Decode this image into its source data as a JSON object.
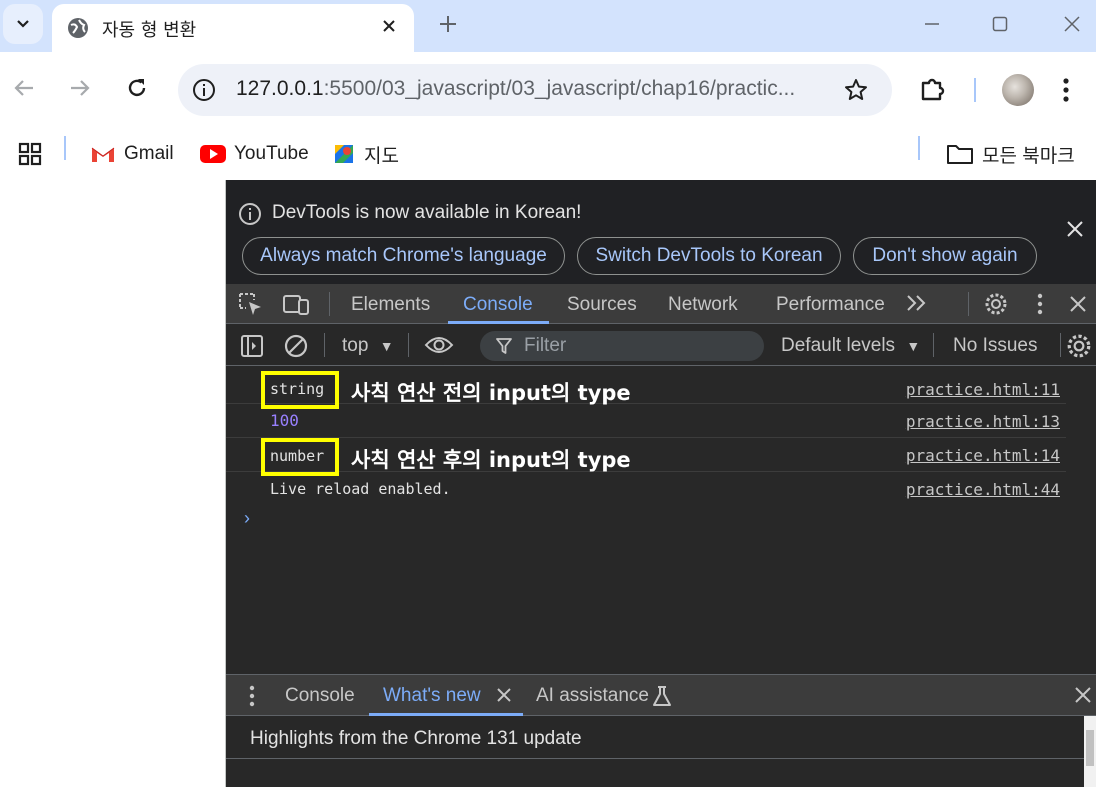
{
  "browser": {
    "tab": {
      "title": "자동 형 변환",
      "favicon": "globe-icon"
    },
    "window_controls": [
      "minimize-icon",
      "maximize-icon",
      "close-icon"
    ],
    "address": {
      "host": "127.0.0.1",
      "path": ":5500/03_javascript/03_javascript/chap16/practic..."
    },
    "bookmarks": [
      {
        "label": "Gmail",
        "icon": "gmail-icon"
      },
      {
        "label": "YouTube",
        "icon": "youtube-icon"
      },
      {
        "label": "지도",
        "icon": "maps-icon"
      }
    ],
    "all_bookmarks": "모든 북마크"
  },
  "devtools": {
    "infobar": {
      "message": "DevTools is now available in Korean!",
      "buttons": [
        "Always match Chrome's language",
        "Switch DevTools to Korean",
        "Don't show again"
      ]
    },
    "tabs": [
      "Elements",
      "Console",
      "Sources",
      "Network",
      "Performance"
    ],
    "active_tab": "Console",
    "toolbar": {
      "context": "top",
      "filter_placeholder": "Filter",
      "levels": "Default levels",
      "issues": "No Issues"
    },
    "messages": [
      {
        "text": "string",
        "source": "practice.html:11",
        "annotation": "사칙 연산 전의 input의 type",
        "highlighted": true
      },
      {
        "text": "100",
        "source": "practice.html:13",
        "color": "#9980ff"
      },
      {
        "text": "number",
        "source": "practice.html:14",
        "annotation": "사칙 연산 후의 input의 type",
        "highlighted": true
      },
      {
        "text": "Live reload enabled.",
        "source": "practice.html:44"
      }
    ],
    "drawer": {
      "tabs": [
        "Console",
        "What's new",
        "AI assistance"
      ],
      "active_tab": "What's new",
      "content": "Highlights from the Chrome 131 update"
    }
  },
  "colors": {
    "highlight_box": "#ffff00",
    "accent": "#7cacf8",
    "number": "#9980ff"
  }
}
